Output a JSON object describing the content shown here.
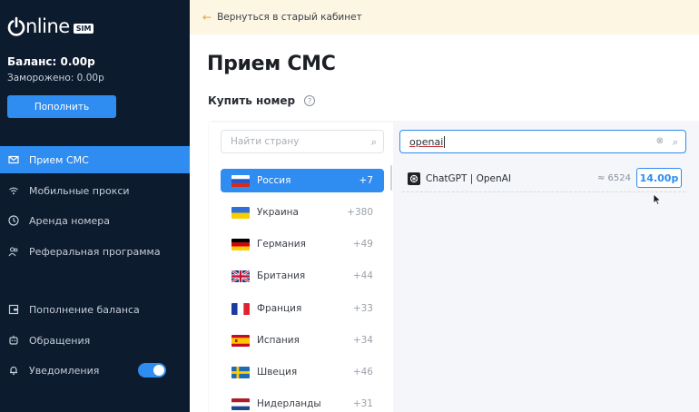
{
  "sidebar": {
    "logo_text": "nline",
    "logo_badge": "SIM",
    "balance": "Баланс: 0.00р",
    "frozen": "Заморожено: 0.00р",
    "topup_label": "Пополнить",
    "nav": [
      {
        "label": "Прием СМС",
        "icon": "envelope-icon",
        "active": true
      },
      {
        "label": "Мобильные прокси",
        "icon": "wifi-icon",
        "active": false
      },
      {
        "label": "Аренда номера",
        "icon": "clock-icon",
        "active": false
      },
      {
        "label": "Реферальная программа",
        "icon": "users-icon",
        "active": false
      },
      {
        "label": "Пополнение баланса",
        "icon": "wallet-icon",
        "active": false
      },
      {
        "label": "Обращения",
        "icon": "support-icon",
        "active": false
      },
      {
        "label": "Уведомления",
        "icon": "bell-icon",
        "active": false
      }
    ],
    "notifications_toggle": true
  },
  "header": {
    "back_label": "Вернуться в старый кабинет"
  },
  "main": {
    "title": "Прием СМС",
    "section_title": "Купить номер",
    "country_search_placeholder": "Найти страну",
    "service_search_value": "openai",
    "countries": [
      {
        "name": "Россия",
        "code": "+7",
        "flag": "ru",
        "active": true
      },
      {
        "name": "Украина",
        "code": "+380",
        "flag": "ua",
        "active": false
      },
      {
        "name": "Германия",
        "code": "+49",
        "flag": "de",
        "active": false
      },
      {
        "name": "Британия",
        "code": "+44",
        "flag": "gb",
        "active": false
      },
      {
        "name": "Франция",
        "code": "+33",
        "flag": "fr",
        "active": false
      },
      {
        "name": "Испания",
        "code": "+34",
        "flag": "es",
        "active": false
      },
      {
        "name": "Швеция",
        "code": "+46",
        "flag": "se",
        "active": false
      },
      {
        "name": "Нидерланды",
        "code": "+31",
        "flag": "nl",
        "active": false
      }
    ],
    "services": [
      {
        "name": "ChatGPT | OpenAI",
        "count": "≈ 6524",
        "price": "14.00р",
        "icon": "openai-icon"
      }
    ]
  },
  "colors": {
    "sidebar_bg": "#0d1b2e",
    "accent": "#2f8cf0",
    "back_bar_bg": "#fdf6e3"
  }
}
